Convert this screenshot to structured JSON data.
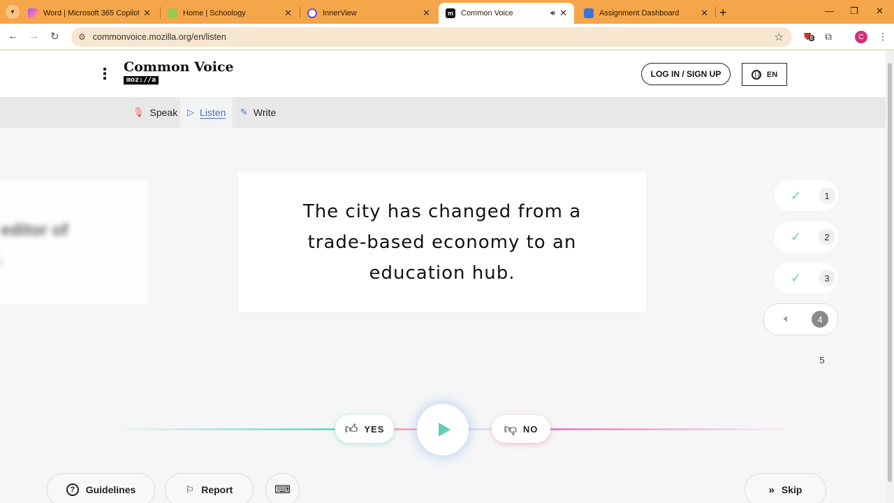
{
  "browser": {
    "tabs": [
      {
        "title": "Word | Microsoft 365 Copilot",
        "favicon": "copilot-icon",
        "color": "#7b61ff",
        "active": false
      },
      {
        "title": "Home | Schoology",
        "favicon": "schoology-icon",
        "color": "#9bc94f",
        "active": false
      },
      {
        "title": "InnerView",
        "favicon": "innerview-icon",
        "color": "#6c4ad8",
        "active": false
      },
      {
        "title": "Common Voice",
        "favicon": "common-voice-icon",
        "color": "#111111",
        "active": true
      },
      {
        "title": "Assignment Dashboard",
        "favicon": "assignment-dashboard-icon",
        "color": "#3c73d8",
        "active": false
      }
    ],
    "url": "commonvoice.mozilla.org/en/listen",
    "extension_badge": "8",
    "profile_initial": "C",
    "accent_color": "#f5a64a"
  },
  "header": {
    "logo_title": "Common Voice",
    "logo_sub": "moz://a",
    "login_label": "LOG IN / SIGN UP",
    "language": "EN"
  },
  "subnav": {
    "speak": "Speak",
    "listen": "Listen",
    "write": "Write"
  },
  "prompt": {
    "previous_blurred": "ry editor of\ns\".",
    "sentence": "The city has changed from a trade-based economy to an education hub."
  },
  "progress": {
    "steps": [
      {
        "number": "1",
        "status": "done"
      },
      {
        "number": "2",
        "status": "done"
      },
      {
        "number": "3",
        "status": "done"
      },
      {
        "number": "4",
        "status": "current"
      },
      {
        "number": "5",
        "status": "pending"
      }
    ],
    "check_color": "#5fcfb9"
  },
  "controls": {
    "yes_label": "YES",
    "no_label": "NO"
  },
  "footer": {
    "guidelines_label": "Guidelines",
    "report_label": "Report",
    "skip_label": "Skip"
  }
}
